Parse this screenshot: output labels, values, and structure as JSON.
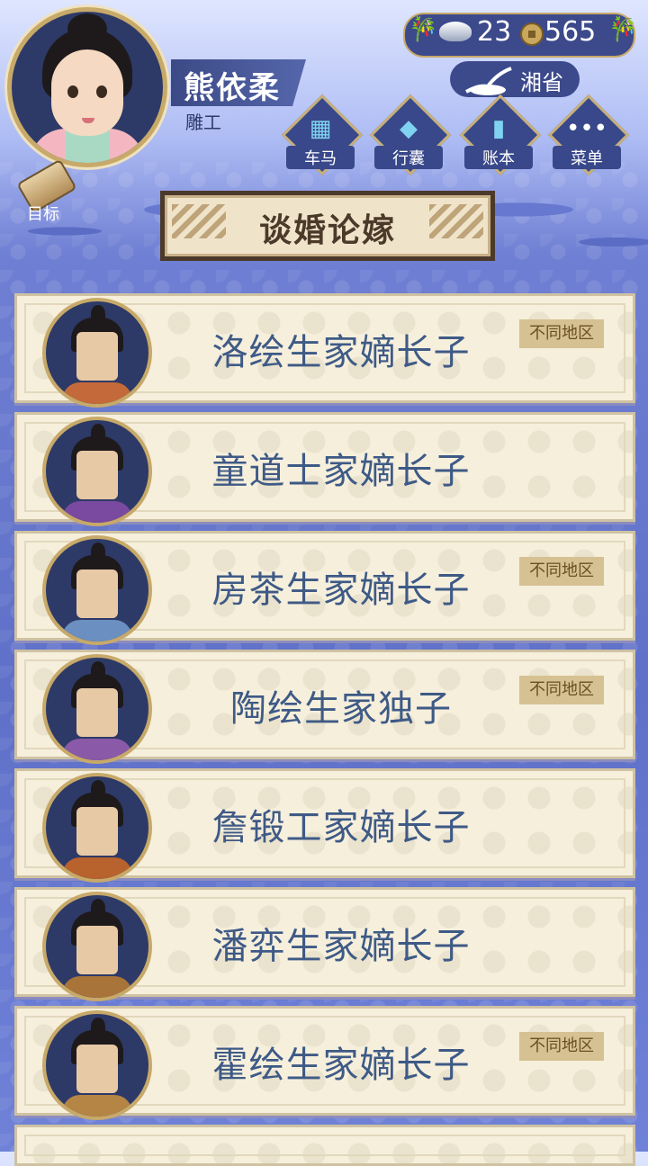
{
  "player": {
    "name": "熊依柔",
    "title": "雕工"
  },
  "currency": {
    "silver": "23",
    "coins": "565"
  },
  "region": {
    "label": "湘省"
  },
  "menu": [
    {
      "label": "车马",
      "icon": "carriage-icon"
    },
    {
      "label": "行囊",
      "icon": "bag-icon"
    },
    {
      "label": "账本",
      "icon": "ledger-icon"
    },
    {
      "label": "菜单",
      "icon": "more-icon"
    }
  ],
  "goal": {
    "label": "目标"
  },
  "screen_title": "谈婚论嫁",
  "suitors": [
    {
      "name": "洛绘生家嫡长子",
      "badge": "不同地区",
      "robe": "#c46a3a"
    },
    {
      "name": "童道士家嫡长子",
      "badge": "",
      "robe": "#7a4aa0"
    },
    {
      "name": "房茶生家嫡长子",
      "badge": "不同地区",
      "robe": "#6b8fc1"
    },
    {
      "name": "陶绘生家独子",
      "badge": "不同地区",
      "robe": "#8a5aa8"
    },
    {
      "name": "詹锻工家嫡长子",
      "badge": "",
      "robe": "#b8622e"
    },
    {
      "name": "潘弈生家嫡长子",
      "badge": "",
      "robe": "#a8743a"
    },
    {
      "name": "霍绘生家嫡长子",
      "badge": "不同地区",
      "robe": "#b58545"
    }
  ]
}
